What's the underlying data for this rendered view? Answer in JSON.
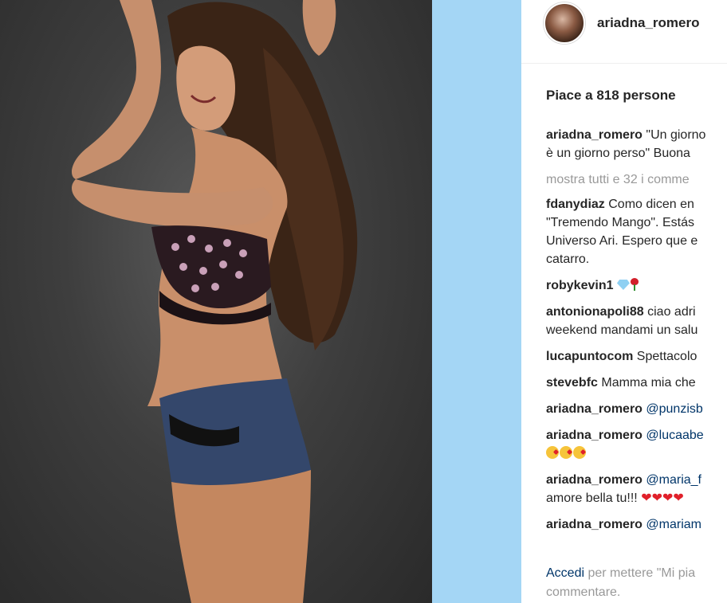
{
  "post": {
    "username": "ariadna_romero",
    "likes_text": "Piace a 818 persone",
    "caption": {
      "user": "ariadna_romero",
      "lines": [
        "\"Un giorno",
        "è un giorno perso\" Buona"
      ]
    },
    "show_all_comments": "mostra tutti e 32 i comme",
    "comments": [
      {
        "user": "fdanydiaz",
        "lines": [
          "Como dicen en",
          "\"Tremendo Mango\". Estás",
          "Universo Ari. Espero que e",
          "catarro."
        ]
      },
      {
        "user": "robykevin1",
        "lines": [
          ""
        ],
        "emoji": [
          "gem-emoji",
          "rose-emoji"
        ]
      },
      {
        "user": "antonionapoli88",
        "lines": [
          "ciao adri",
          "weekend mandami un salu"
        ]
      },
      {
        "user": "lucapuntocom",
        "lines": [
          "Spettacolo"
        ]
      },
      {
        "user": "stevebfc",
        "lines": [
          "Mamma mia che"
        ]
      },
      {
        "user": "ariadna_romero",
        "mention": "@punzisb",
        "lines": [
          ""
        ]
      },
      {
        "user": "ariadna_romero",
        "mention": "@lucaabe",
        "lines": [
          ""
        ],
        "emoji": [
          "kiss-emoji",
          "kiss-emoji",
          "kiss-emoji"
        ]
      },
      {
        "user": "ariadna_romero",
        "mention": "@maria_f",
        "lines": [
          "amore bella tu!!!"
        ],
        "emoji_after_line": [
          "heart-emoji",
          "heart-emoji",
          "heart-emoji",
          "heart-emoji"
        ]
      },
      {
        "user": "ariadna_romero",
        "mention": "@mariam",
        "lines": [
          ""
        ]
      }
    ],
    "footer": {
      "login_link": "Accedi",
      "line1_rest": " per mettere \"Mi pia",
      "line2": "commentare."
    }
  },
  "colors": {
    "side_gap": "#a4d6f5",
    "link": "#003569",
    "muted": "#999999"
  }
}
